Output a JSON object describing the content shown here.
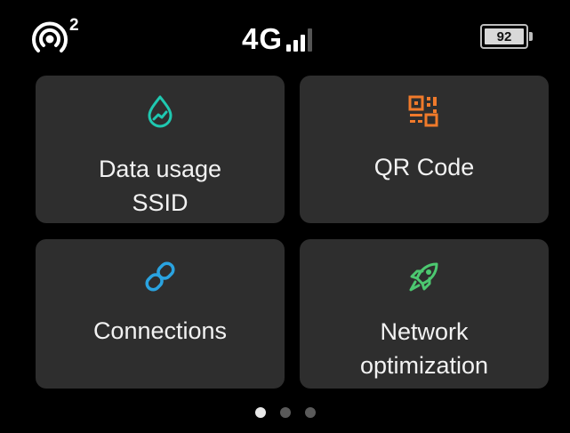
{
  "status_bar": {
    "hotspot_icon": "wifi-hotspot-icon",
    "connected_count": "2",
    "network_type": "4G",
    "signal_icon": "signal-bars-icon",
    "signal_bars_filled": 3,
    "signal_bars_total": 4,
    "battery_icon": "battery-icon",
    "battery_level": "92"
  },
  "tiles": [
    {
      "label_line1": "Data usage",
      "label_line2": "SSID",
      "icon": "water-drop-chart-icon",
      "color": "#1fc8b0"
    },
    {
      "label_line1": "QR Code",
      "label_line2": "",
      "icon": "qr-code-icon",
      "color": "#f07a2b"
    },
    {
      "label_line1": "Connections",
      "label_line2": "",
      "icon": "link-icon",
      "color": "#2aa3e0"
    },
    {
      "label_line1": "Network",
      "label_line2": "optimization",
      "icon": "rocket-icon",
      "color": "#4cc870"
    }
  ],
  "pager": {
    "pages": 3,
    "active_page": 1
  },
  "colors": {
    "background": "#000000",
    "tile_background": "#2e2e2e",
    "text": "#f2f2f2"
  }
}
